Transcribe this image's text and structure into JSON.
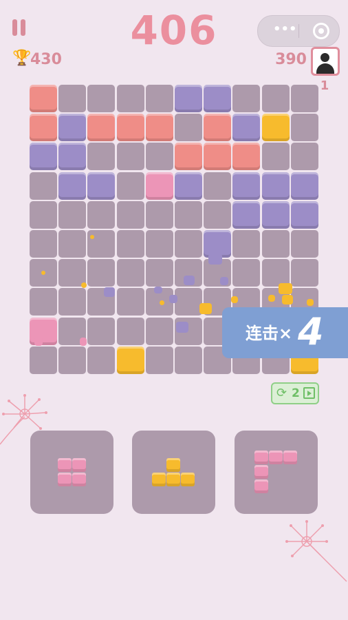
{
  "score": "406",
  "best_score": "430",
  "opponent_score": "390",
  "rank": "1",
  "combo": {
    "text": "连击×",
    "count": "4"
  },
  "refresh_count": "2",
  "colors": {
    "red": "#ef8d87",
    "purple": "#9c8dc7",
    "yellow": "#f7bb2d",
    "pink": "#ec95b7",
    "empty": "#ad9aab",
    "background": "#f1e6ef"
  },
  "board": {
    "cols": 10,
    "rows": 10,
    "cells": [
      "r....pp...",
      "rprrr.rpy.",
      "pp...rrr..",
      ".pp.kp.ppp",
      ".......ppp",
      "......p...",
      "..........",
      "..........",
      "k.........",
      "...y.....y"
    ]
  },
  "pieces": [
    {
      "name": "square-2x2-pink",
      "color": "pink",
      "shape": [
        "xx",
        "xx"
      ]
    },
    {
      "name": "t-shape-yellow",
      "color": "yellow",
      "shape": [
        ".x.",
        "xxx"
      ]
    },
    {
      "name": "corner-pink",
      "color": "pink",
      "shape": [
        "xxx",
        "x..",
        "x.."
      ]
    }
  ],
  "icons": [
    "pause-icon",
    "trophy-icon",
    "more-icon",
    "close-target-icon",
    "avatar-icon",
    "refresh-icon",
    "video-icon"
  ]
}
